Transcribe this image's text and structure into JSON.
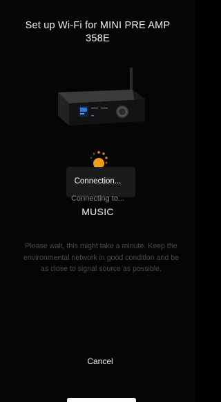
{
  "header": {
    "title": "Set up Wi-Fi for MINI PRE AMP 358E"
  },
  "device": {
    "icon": "amplifier-device-image",
    "screen_color": "#2a7bd8"
  },
  "spinner": {
    "icon": "loading-spinner-icon",
    "accent": "#f39c12"
  },
  "toast": {
    "text": "Connection..."
  },
  "status": {
    "connecting_label": "Connecting to...",
    "network_name": "MUSIC"
  },
  "message": {
    "text": "Please wait, this might take a minute. Keep the environmental network in good condition and be as close to signal source as possible."
  },
  "actions": {
    "cancel_label": "Cancel"
  }
}
